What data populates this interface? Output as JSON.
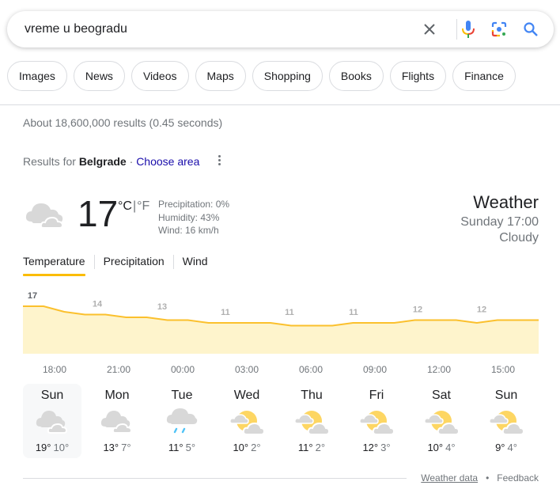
{
  "search": {
    "query": "vreme u beogradu",
    "icons": [
      "close-icon",
      "microphone-icon",
      "lens-icon",
      "search-icon"
    ]
  },
  "chips": [
    "Images",
    "News",
    "Videos",
    "Maps",
    "Shopping",
    "Books",
    "Flights",
    "Finance"
  ],
  "stats": "About 18,600,000 results (0.45 seconds)",
  "results_for": {
    "prefix": "Results for ",
    "location": "Belgrade",
    "separator": " · ",
    "choose_area": "Choose area"
  },
  "current": {
    "temperature": "17",
    "unit_c": "°C",
    "unit_sep": "|",
    "unit_f": "°F",
    "precipitation": "Precipitation: 0%",
    "humidity": "Humidity: 43%",
    "wind": "Wind: 16 km/h",
    "icon": "cloudy-icon",
    "title": "Weather",
    "datetime": "Sunday 17:00",
    "condition": "Cloudy"
  },
  "tabs": [
    {
      "label": "Temperature",
      "active": true
    },
    {
      "label": "Precipitation",
      "active": false
    },
    {
      "label": "Wind",
      "active": false
    }
  ],
  "chart_data": {
    "type": "area",
    "title": "Temperature",
    "xlabel": "",
    "ylabel": "",
    "x_tick_labels": [
      "18:00",
      "21:00",
      "00:00",
      "03:00",
      "06:00",
      "09:00",
      "12:00",
      "15:00"
    ],
    "hourly_values": [
      17,
      17,
      15,
      14,
      14,
      13,
      13,
      12,
      12,
      11,
      11,
      11,
      11,
      10,
      10,
      10,
      11,
      11,
      11,
      12,
      12,
      12,
      11,
      12,
      12,
      12
    ],
    "data_labels": [
      {
        "label": "17",
        "highlight": true
      },
      {
        "label": "14",
        "highlight": false
      },
      {
        "label": "13",
        "highlight": false
      },
      {
        "label": "11",
        "highlight": false
      },
      {
        "label": "11",
        "highlight": false
      },
      {
        "label": "11",
        "highlight": false
      },
      {
        "label": "12",
        "highlight": false
      },
      {
        "label": "12",
        "highlight": false
      }
    ],
    "line_color": "#fbc02d",
    "fill_color": "#fef4cc",
    "grid": false
  },
  "forecast": [
    {
      "day": "Sun",
      "high": "19°",
      "low": "10°",
      "icon": "cloudy",
      "active": true
    },
    {
      "day": "Mon",
      "high": "13°",
      "low": "7°",
      "icon": "cloudy",
      "active": false
    },
    {
      "day": "Tue",
      "high": "11°",
      "low": "5°",
      "icon": "rain",
      "active": false
    },
    {
      "day": "Wed",
      "high": "10°",
      "low": "2°",
      "icon": "partly-cloudy",
      "active": false
    },
    {
      "day": "Thu",
      "high": "11°",
      "low": "2°",
      "icon": "partly-cloudy",
      "active": false
    },
    {
      "day": "Fri",
      "high": "12°",
      "low": "3°",
      "icon": "partly-cloudy",
      "active": false
    },
    {
      "day": "Sat",
      "high": "10°",
      "low": "4°",
      "icon": "partly-cloudy",
      "active": false
    },
    {
      "day": "Sun",
      "high": "9°",
      "low": "4°",
      "icon": "partly-cloudy",
      "active": false
    }
  ],
  "footer": {
    "weather_data": "Weather data",
    "dot": "•",
    "feedback": "Feedback"
  }
}
